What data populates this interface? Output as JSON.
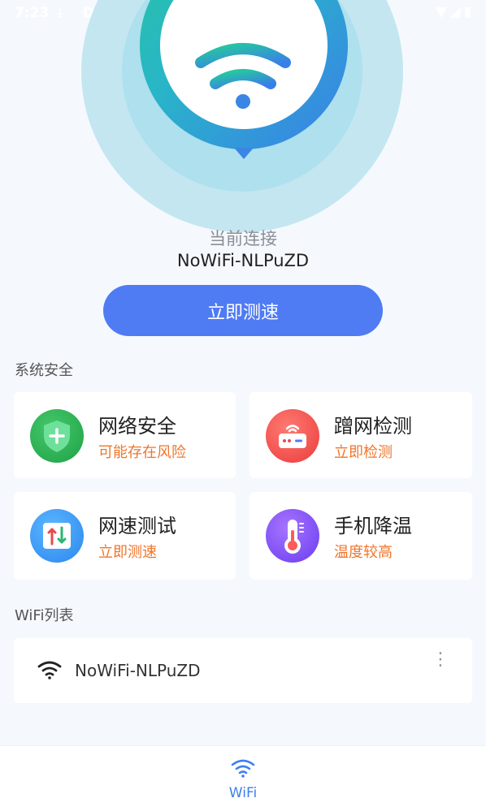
{
  "status_bar": {
    "time": "7:23",
    "download_glyph": "⤓",
    "d_glyph": "D",
    "right_glyphs": "▼◢▮"
  },
  "hero": {
    "caption": "当前连接",
    "ssid": "NoWiFi-NLPuZD",
    "button_label": "立即测速"
  },
  "system_security": {
    "title": "系统安全",
    "cards": [
      {
        "title": "网络安全",
        "subtitle": "可能存在风险",
        "icon": "shield-icon"
      },
      {
        "title": "蹭网检测",
        "subtitle": "立即检测",
        "icon": "router-icon"
      },
      {
        "title": "网速测试",
        "subtitle": "立即测速",
        "icon": "speed-test-icon"
      },
      {
        "title": "手机降温",
        "subtitle": "温度较高",
        "icon": "thermometer-icon"
      }
    ]
  },
  "wifi_list": {
    "title": "WiFi列表",
    "items": [
      {
        "ssid": "NoWiFi-NLPuZD",
        "more": "⋮"
      }
    ]
  },
  "bottom_nav": {
    "tabs": [
      {
        "label": "WiFi",
        "active": true
      }
    ]
  },
  "colors": {
    "accent": "#4f7bf3",
    "warning": "#f0762c",
    "bg": "#f5f9fe"
  }
}
